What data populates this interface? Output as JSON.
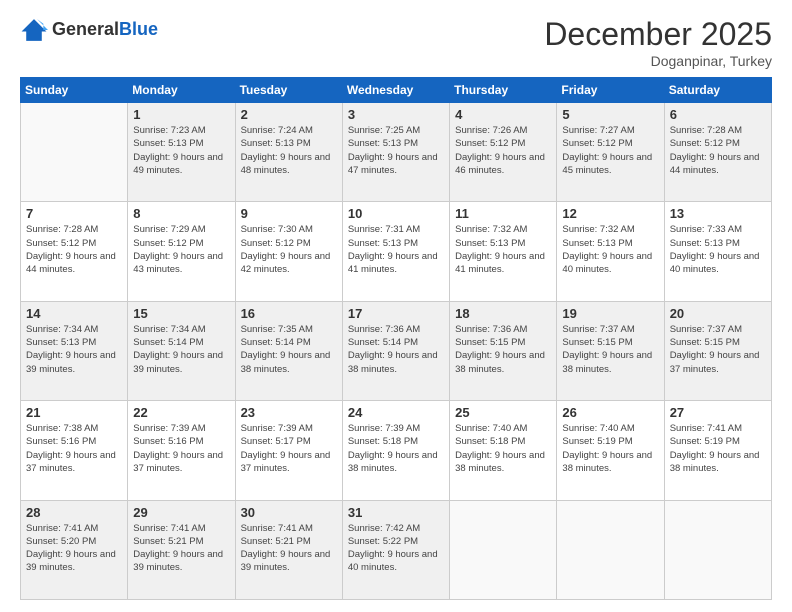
{
  "logo": {
    "general": "General",
    "blue": "Blue"
  },
  "header": {
    "month": "December 2025",
    "location": "Doganpinar, Turkey"
  },
  "weekdays": [
    "Sunday",
    "Monday",
    "Tuesday",
    "Wednesday",
    "Thursday",
    "Friday",
    "Saturday"
  ],
  "weeks": [
    [
      {
        "day": "",
        "sunrise": "",
        "sunset": "",
        "daylight": ""
      },
      {
        "day": "1",
        "sunrise": "7:23 AM",
        "sunset": "5:13 PM",
        "daylight": "9 hours and 49 minutes."
      },
      {
        "day": "2",
        "sunrise": "7:24 AM",
        "sunset": "5:13 PM",
        "daylight": "9 hours and 48 minutes."
      },
      {
        "day": "3",
        "sunrise": "7:25 AM",
        "sunset": "5:13 PM",
        "daylight": "9 hours and 47 minutes."
      },
      {
        "day": "4",
        "sunrise": "7:26 AM",
        "sunset": "5:12 PM",
        "daylight": "9 hours and 46 minutes."
      },
      {
        "day": "5",
        "sunrise": "7:27 AM",
        "sunset": "5:12 PM",
        "daylight": "9 hours and 45 minutes."
      },
      {
        "day": "6",
        "sunrise": "7:28 AM",
        "sunset": "5:12 PM",
        "daylight": "9 hours and 44 minutes."
      }
    ],
    [
      {
        "day": "7",
        "sunrise": "7:28 AM",
        "sunset": "5:12 PM",
        "daylight": "9 hours and 44 minutes."
      },
      {
        "day": "8",
        "sunrise": "7:29 AM",
        "sunset": "5:12 PM",
        "daylight": "9 hours and 43 minutes."
      },
      {
        "day": "9",
        "sunrise": "7:30 AM",
        "sunset": "5:12 PM",
        "daylight": "9 hours and 42 minutes."
      },
      {
        "day": "10",
        "sunrise": "7:31 AM",
        "sunset": "5:13 PM",
        "daylight": "9 hours and 41 minutes."
      },
      {
        "day": "11",
        "sunrise": "7:32 AM",
        "sunset": "5:13 PM",
        "daylight": "9 hours and 41 minutes."
      },
      {
        "day": "12",
        "sunrise": "7:32 AM",
        "sunset": "5:13 PM",
        "daylight": "9 hours and 40 minutes."
      },
      {
        "day": "13",
        "sunrise": "7:33 AM",
        "sunset": "5:13 PM",
        "daylight": "9 hours and 40 minutes."
      }
    ],
    [
      {
        "day": "14",
        "sunrise": "7:34 AM",
        "sunset": "5:13 PM",
        "daylight": "9 hours and 39 minutes."
      },
      {
        "day": "15",
        "sunrise": "7:34 AM",
        "sunset": "5:14 PM",
        "daylight": "9 hours and 39 minutes."
      },
      {
        "day": "16",
        "sunrise": "7:35 AM",
        "sunset": "5:14 PM",
        "daylight": "9 hours and 38 minutes."
      },
      {
        "day": "17",
        "sunrise": "7:36 AM",
        "sunset": "5:14 PM",
        "daylight": "9 hours and 38 minutes."
      },
      {
        "day": "18",
        "sunrise": "7:36 AM",
        "sunset": "5:15 PM",
        "daylight": "9 hours and 38 minutes."
      },
      {
        "day": "19",
        "sunrise": "7:37 AM",
        "sunset": "5:15 PM",
        "daylight": "9 hours and 38 minutes."
      },
      {
        "day": "20",
        "sunrise": "7:37 AM",
        "sunset": "5:15 PM",
        "daylight": "9 hours and 37 minutes."
      }
    ],
    [
      {
        "day": "21",
        "sunrise": "7:38 AM",
        "sunset": "5:16 PM",
        "daylight": "9 hours and 37 minutes."
      },
      {
        "day": "22",
        "sunrise": "7:39 AM",
        "sunset": "5:16 PM",
        "daylight": "9 hours and 37 minutes."
      },
      {
        "day": "23",
        "sunrise": "7:39 AM",
        "sunset": "5:17 PM",
        "daylight": "9 hours and 37 minutes."
      },
      {
        "day": "24",
        "sunrise": "7:39 AM",
        "sunset": "5:18 PM",
        "daylight": "9 hours and 38 minutes."
      },
      {
        "day": "25",
        "sunrise": "7:40 AM",
        "sunset": "5:18 PM",
        "daylight": "9 hours and 38 minutes."
      },
      {
        "day": "26",
        "sunrise": "7:40 AM",
        "sunset": "5:19 PM",
        "daylight": "9 hours and 38 minutes."
      },
      {
        "day": "27",
        "sunrise": "7:41 AM",
        "sunset": "5:19 PM",
        "daylight": "9 hours and 38 minutes."
      }
    ],
    [
      {
        "day": "28",
        "sunrise": "7:41 AM",
        "sunset": "5:20 PM",
        "daylight": "9 hours and 39 minutes."
      },
      {
        "day": "29",
        "sunrise": "7:41 AM",
        "sunset": "5:21 PM",
        "daylight": "9 hours and 39 minutes."
      },
      {
        "day": "30",
        "sunrise": "7:41 AM",
        "sunset": "5:21 PM",
        "daylight": "9 hours and 39 minutes."
      },
      {
        "day": "31",
        "sunrise": "7:42 AM",
        "sunset": "5:22 PM",
        "daylight": "9 hours and 40 minutes."
      },
      {
        "day": "",
        "sunrise": "",
        "sunset": "",
        "daylight": ""
      },
      {
        "day": "",
        "sunrise": "",
        "sunset": "",
        "daylight": ""
      },
      {
        "day": "",
        "sunrise": "",
        "sunset": "",
        "daylight": ""
      }
    ]
  ],
  "labels": {
    "sunrise": "Sunrise:",
    "sunset": "Sunset:",
    "daylight": "Daylight:"
  }
}
